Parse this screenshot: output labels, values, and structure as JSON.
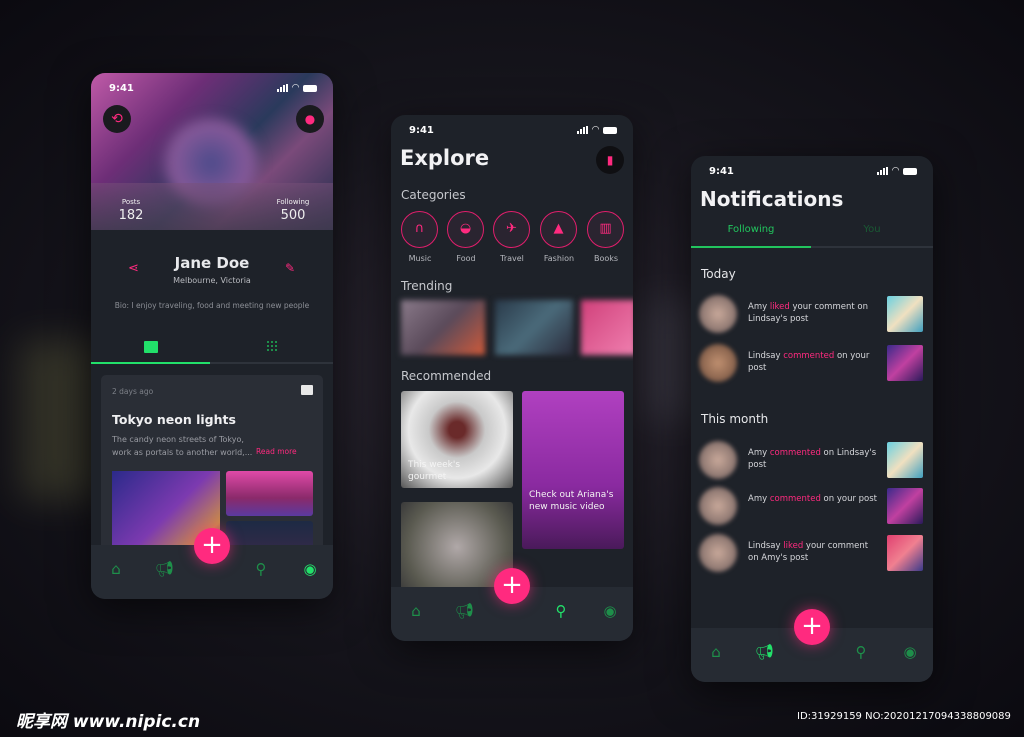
{
  "colors": {
    "accent_green": "#22e06a",
    "accent_pink": "#ff2a7f",
    "phone_bg": "#1e2229",
    "nav_bg": "#262b33"
  },
  "status_time": "9:41",
  "profile": {
    "stats": [
      {
        "label": "Posts",
        "value": "182"
      },
      {
        "label": "Following",
        "value": "500"
      }
    ],
    "name": "Jane Doe",
    "location": "Melbourne, Victoria",
    "bio": "Bio: I enjoy traveling, food and meeting new people",
    "tabs": [
      "list-view",
      "grid-view"
    ],
    "post": {
      "time": "2 days ago",
      "title": "Tokyo neon lights",
      "description": "The candy neon streets of Tokyo, work as portals to another world,...",
      "read_more": "Read more"
    },
    "nav": [
      "home",
      "megaphone",
      "search",
      "profile"
    ],
    "nav_active": "profile"
  },
  "explore": {
    "title": "Explore",
    "categories_title": "Categories",
    "categories": [
      {
        "label": "Music",
        "icon": "headphones"
      },
      {
        "label": "Food",
        "icon": "bowl"
      },
      {
        "label": "Travel",
        "icon": "plane"
      },
      {
        "label": "Fashion",
        "icon": "dress"
      },
      {
        "label": "Books",
        "icon": "books"
      }
    ],
    "trending_title": "Trending",
    "recommended_title": "Recommended",
    "cards": [
      {
        "caption": "This week's gourmet"
      },
      {
        "caption": "Check out Ariana's new music video"
      },
      {
        "caption": ""
      }
    ],
    "nav_active": "search"
  },
  "notifications": {
    "title": "Notifications",
    "tabs": [
      {
        "label": "Following",
        "active": true
      },
      {
        "label": "You",
        "active": false
      }
    ],
    "sections": [
      {
        "title": "Today",
        "items": [
          {
            "pre": "Amy ",
            "action": "liked",
            "post": " your comment on  Lindsay's post"
          },
          {
            "pre": "Lindsay ",
            "action": "commented",
            "post": " on your post"
          }
        ]
      },
      {
        "title": "This month",
        "items": [
          {
            "pre": "Amy ",
            "action": "commented",
            "post": " on Lindsay's post"
          },
          {
            "pre": "Amy ",
            "action": "commented",
            "post": " on your post"
          },
          {
            "pre": "Lindsay ",
            "action": "liked",
            "post": " your comment on Amy's post"
          }
        ]
      }
    ],
    "nav_active": "megaphone"
  },
  "watermark": {
    "logo": "昵享网 www.nipic.cn",
    "id": "ID:31929159 NO:20201217094338809089"
  }
}
